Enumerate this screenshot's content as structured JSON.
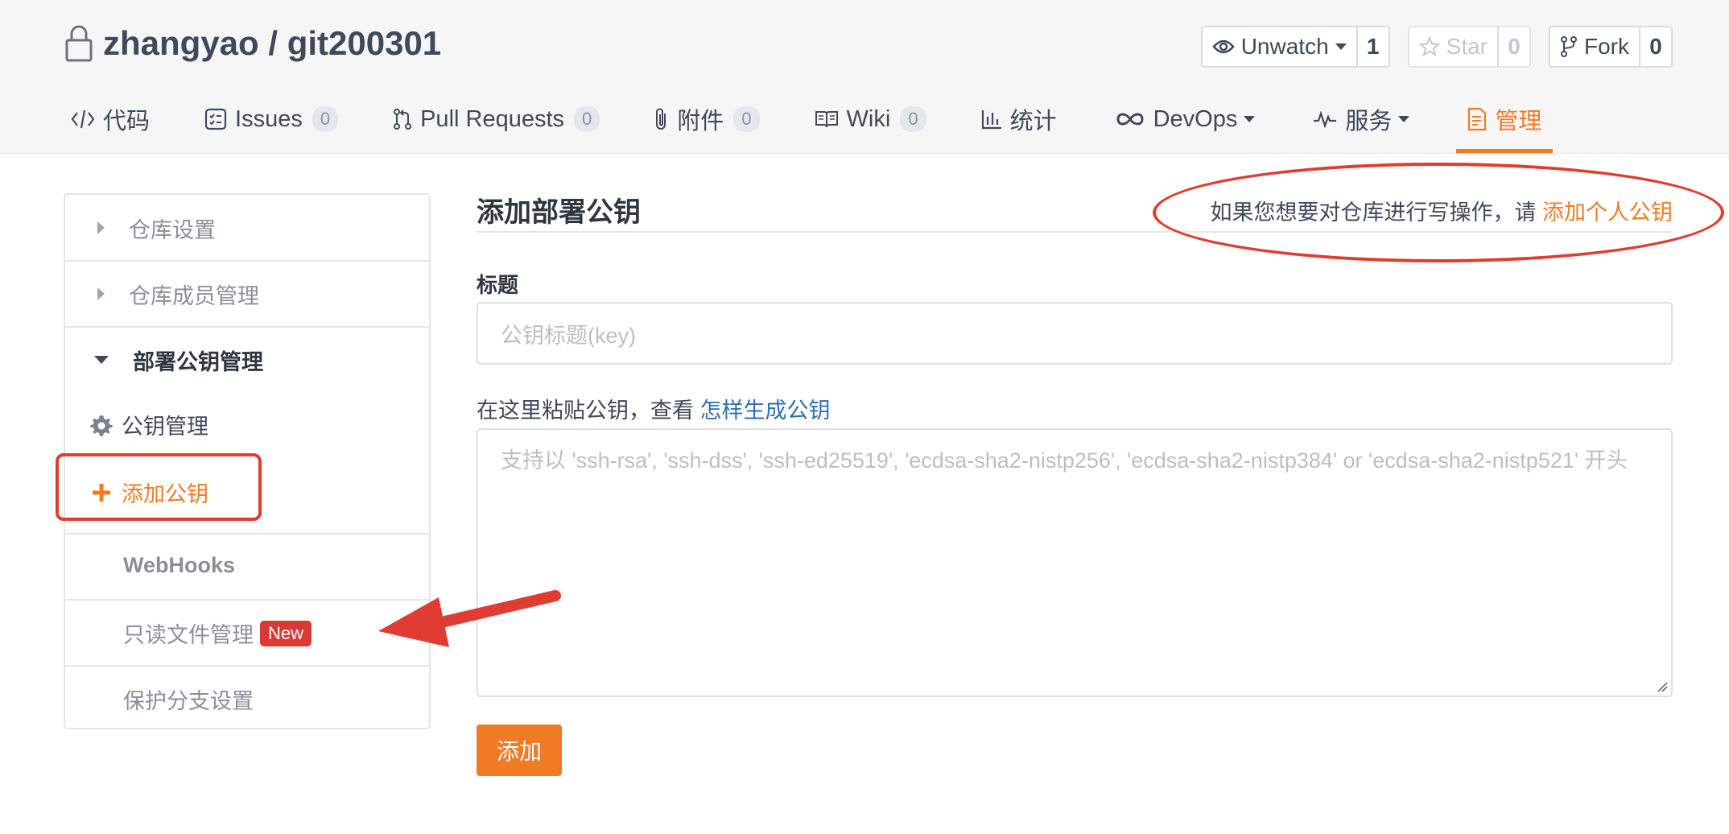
{
  "repo": {
    "title": "zhangyao / git200301",
    "icon": "lock-icon"
  },
  "actions": [
    {
      "label": "Unwatch",
      "count": "1",
      "icon": "eye-icon"
    },
    {
      "label": "Star",
      "count": "0",
      "icon": "star-icon"
    },
    {
      "label": "Fork",
      "count": "0",
      "icon": "fork-icon"
    }
  ],
  "tabs": [
    {
      "label": "代码",
      "icon": "code-icon"
    },
    {
      "label": "Issues",
      "badge": "0",
      "icon": "issues-icon"
    },
    {
      "label": "Pull Requests",
      "badge": "0",
      "icon": "pull-request-icon"
    },
    {
      "label": "附件",
      "badge": "0",
      "icon": "paperclip-icon"
    },
    {
      "label": "Wiki",
      "badge": "0",
      "icon": "book-icon"
    },
    {
      "label": "统计",
      "icon": "bar-chart-icon"
    },
    {
      "label": "DevOps",
      "icon": "infinity-icon"
    },
    {
      "label": "服务",
      "icon": "pulse-icon"
    },
    {
      "label": "管理",
      "icon": "document-icon",
      "active": true
    }
  ],
  "sidebar": {
    "repo_settings": "仓库设置",
    "member_management": "仓库成员管理",
    "deploy_keys": "部署公钥管理",
    "key_management": "公钥管理",
    "add_key": "添加公钥",
    "webhooks": "WebHooks",
    "readonly_files": "只读文件管理",
    "new_badge": "New",
    "branch_protection": "保护分支设置"
  },
  "form": {
    "title": "添加部署公钥",
    "hint_prefix": "如果您想要对仓库进行写操作，请 ",
    "hint_link": "添加个人公钥",
    "title_label": "标题",
    "title_placeholder": "公钥标题(key)",
    "paste_label": "在这里粘贴公钥，查看 ",
    "paste_link": "怎样生成公钥",
    "key_placeholder": "支持以 'ssh-rsa', 'ssh-dss', 'ssh-ed25519', 'ecdsa-sha2-nistp256', 'ecdsa-sha2-nistp384' or 'ecdsa-sha2-nistp521' 开头",
    "submit": "添加"
  },
  "colors": {
    "accent": "#f07b24",
    "annotation": "#e03c31",
    "link": "#2f6fb3"
  }
}
